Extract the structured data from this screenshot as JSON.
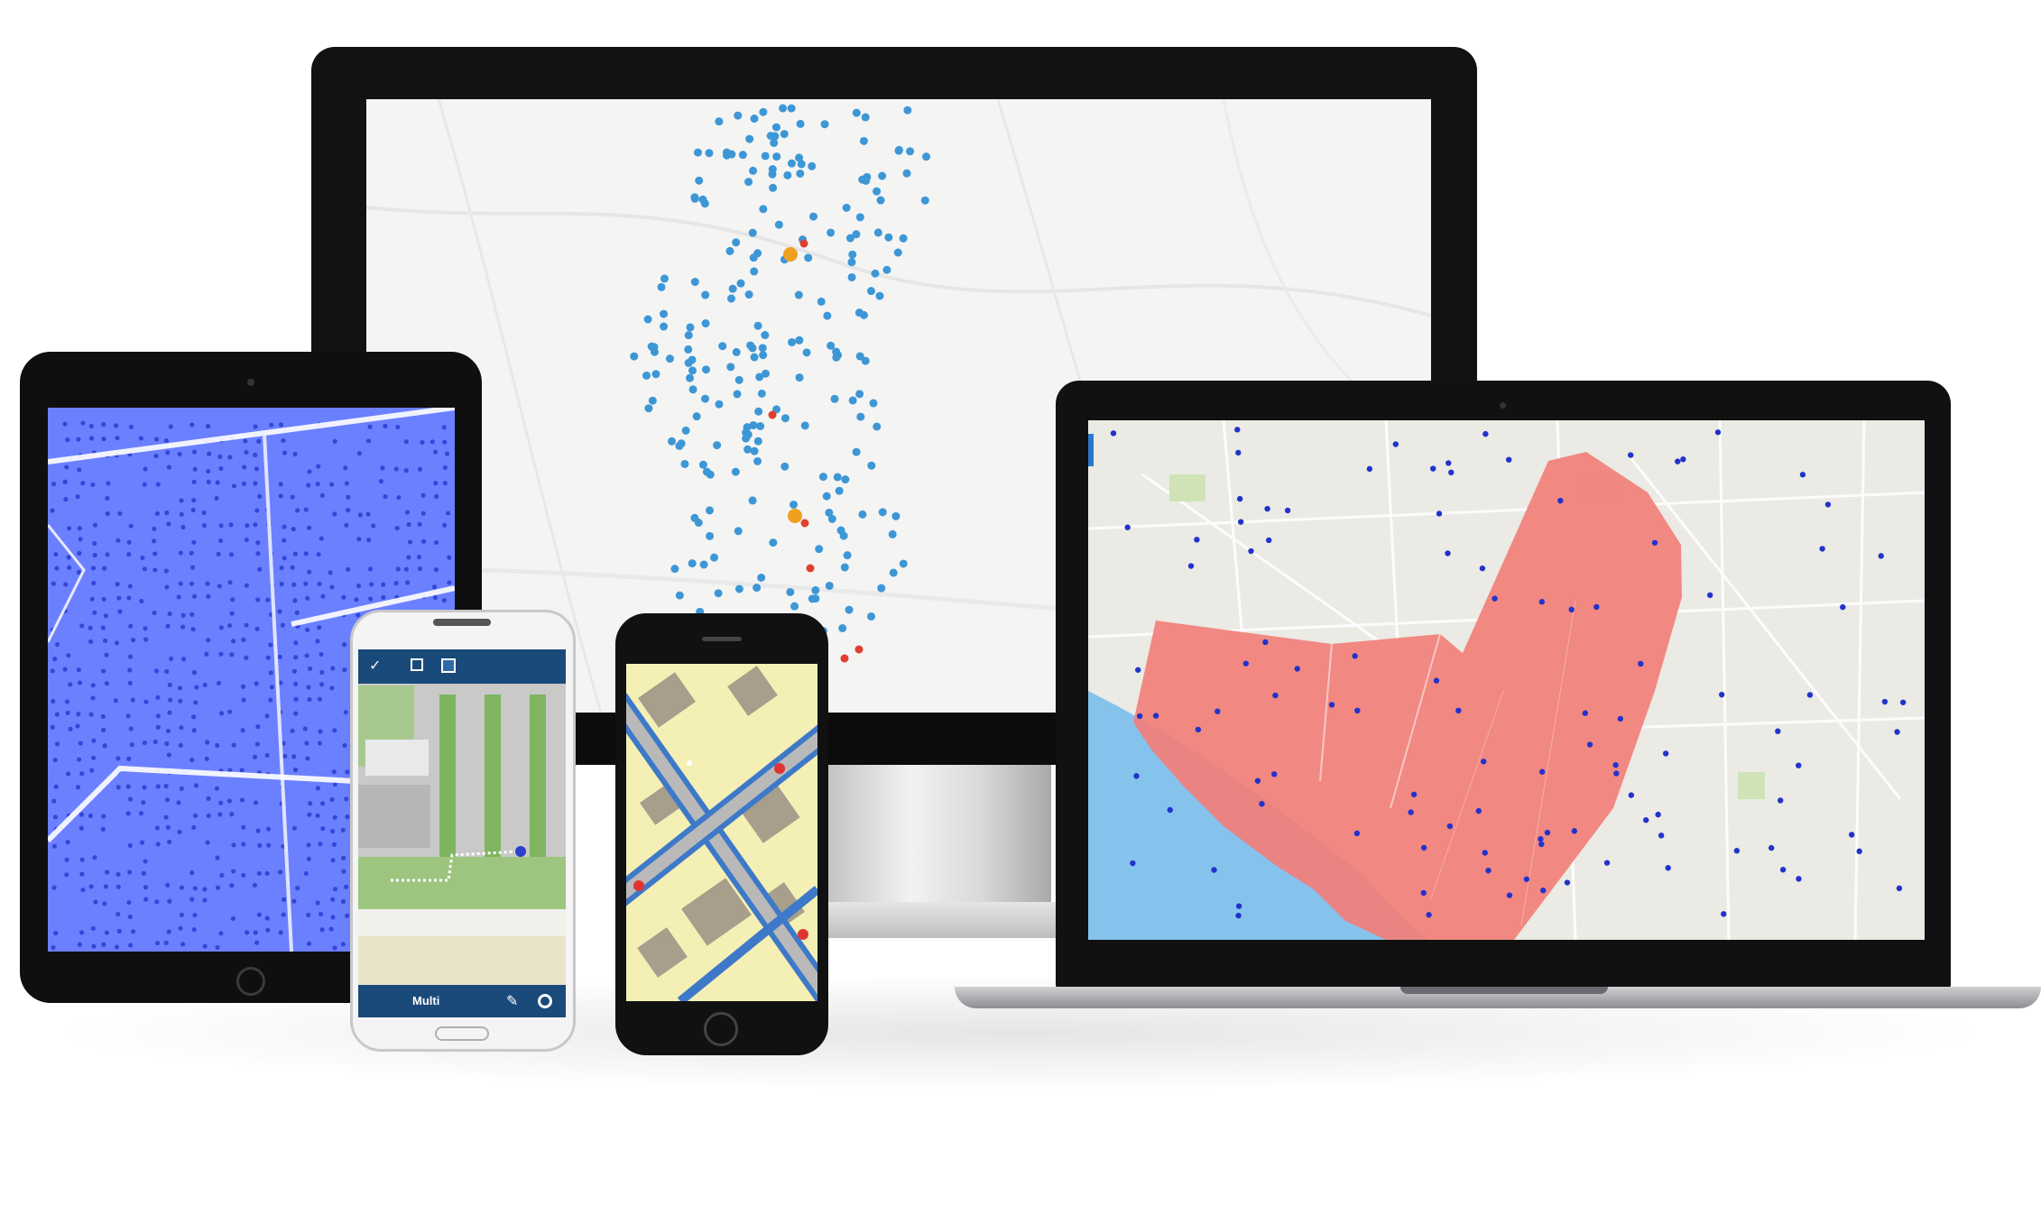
{
  "android_app": {
    "toolbar": {
      "confirm_icon": "check-icon",
      "list_icon": "list-icon",
      "edit_icon": "edit-square-icon"
    },
    "bottombar": {
      "label": "Multi",
      "draw_icon": "pencil-icon",
      "locate_icon": "locate-icon"
    }
  },
  "colors": {
    "monitor_point": "#3d97d6",
    "monitor_point_alt": "#f0a020",
    "monitor_point_red": "#e04030",
    "tablet_fill": "#6b80ff",
    "laptop_polygon": "#f27f7a",
    "laptop_water": "#86c3ec",
    "laptop_point": "#2233cc",
    "iphone_street": "#3d79c8",
    "android_bar": "#1a4a7a"
  }
}
